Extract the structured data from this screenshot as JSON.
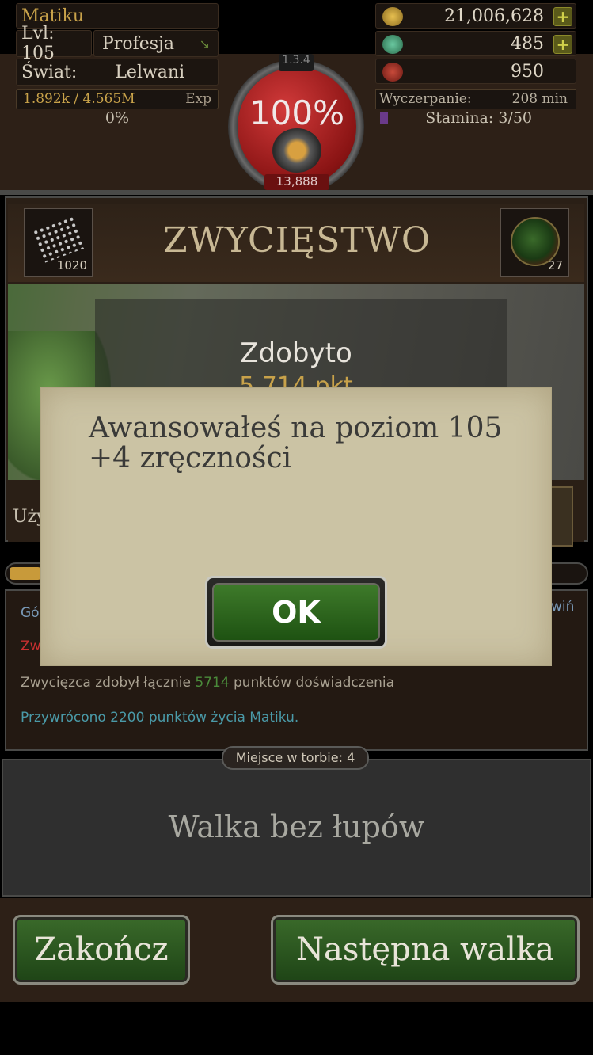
{
  "header": {
    "player_name": "Matiku",
    "level_label": "Lvl: 105",
    "profession_label": "Profesja",
    "world_label": "Świat:",
    "world_value": "Lelwani",
    "exp_value": "1.892k / 4.565M",
    "exp_label": "Exp",
    "exp_percent": "0%",
    "hp_percent": "100%",
    "orb_top": "1.3.4",
    "orb_bottom": "13,888",
    "gold": "21,006,628",
    "gems": "485",
    "bag_points": "950",
    "exhaustion_label": "Wyczerpanie:",
    "exhaustion_value": "208 min",
    "stamina": "Stamina: 3/50",
    "plus_symbol": "+"
  },
  "battle": {
    "title": "ZWYCIĘSTWO",
    "left_item_count": "1020",
    "right_item_count": "27",
    "gained_label": "Zdobyto",
    "gained_points": "5 714 pkt",
    "use_label": "Uży"
  },
  "log": {
    "line1": "Gór",
    "line1_right": "wiń",
    "line2": "Zw",
    "win_prefix": "Zwycięzca zdobył łącznie ",
    "win_points": "5714",
    "win_suffix": " punktów doświadczenia",
    "heal_line": "Przywrócono 2200 punktów życia Matiku."
  },
  "bag": {
    "label": "Miejsce w torbie: 4"
  },
  "loot": {
    "text": "Walka bez łupów"
  },
  "buttons": {
    "end": "Zakończ",
    "next": "Następna walka"
  },
  "modal": {
    "message": "Awansowałeś  na poziom 105\n+4 zręczności",
    "ok": "OK"
  },
  "colors": {
    "gold_text": "#c8a24a",
    "button_green": "#2a5a1e",
    "parchment": "#cbc3a4",
    "hp_red": "#b82424"
  }
}
